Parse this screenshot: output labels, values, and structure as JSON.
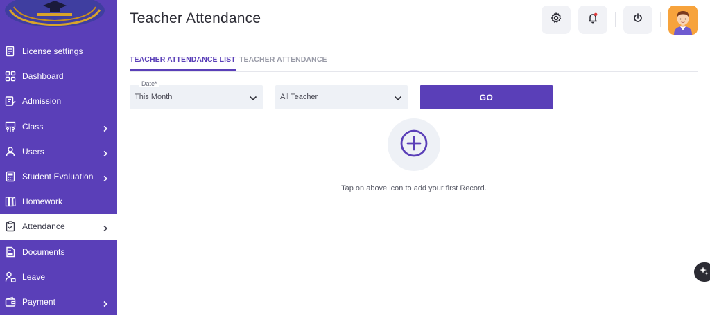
{
  "header": {
    "title": "Teacher Attendance",
    "settings_icon": "gear-icon",
    "notification_icon": "bell-icon",
    "power_icon": "power-icon"
  },
  "sidebar": {
    "items": [
      {
        "label": "License settings",
        "icon": "license-icon",
        "has_chevron": false
      },
      {
        "label": "Dashboard",
        "icon": "grid-icon",
        "has_chevron": false
      },
      {
        "label": "Admission",
        "icon": "form-edit-icon",
        "has_chevron": false
      },
      {
        "label": "Class",
        "icon": "classroom-icon",
        "has_chevron": true
      },
      {
        "label": "Users",
        "icon": "user-icon",
        "has_chevron": true
      },
      {
        "label": "Student Evaluation",
        "icon": "calculator-icon",
        "has_chevron": true
      },
      {
        "label": "Homework",
        "icon": "books-icon",
        "has_chevron": false
      },
      {
        "label": "Attendance",
        "icon": "clipboard-check-icon",
        "has_chevron": true,
        "active": true
      },
      {
        "label": "Documents",
        "icon": "document-icon",
        "has_chevron": false
      },
      {
        "label": "Leave",
        "icon": "leave-icon",
        "has_chevron": false
      },
      {
        "label": "Payment",
        "icon": "wallet-icon",
        "has_chevron": true
      }
    ]
  },
  "tabs": [
    {
      "label": "TEACHER ATTENDANCE LIST",
      "active": true
    },
    {
      "label": "TEACHER ATTENDANCE",
      "active": false
    }
  ],
  "filters": {
    "date_label": "Date*",
    "date_value": "This Month",
    "teacher_value": "All Teacher",
    "go_label": "GO"
  },
  "empty_state": {
    "text": "Tap on above icon to add your first Record."
  },
  "colors": {
    "primary": "#5a3fb8",
    "field_bg": "#eef1f6",
    "avatar_bg": "#f7a33c"
  }
}
